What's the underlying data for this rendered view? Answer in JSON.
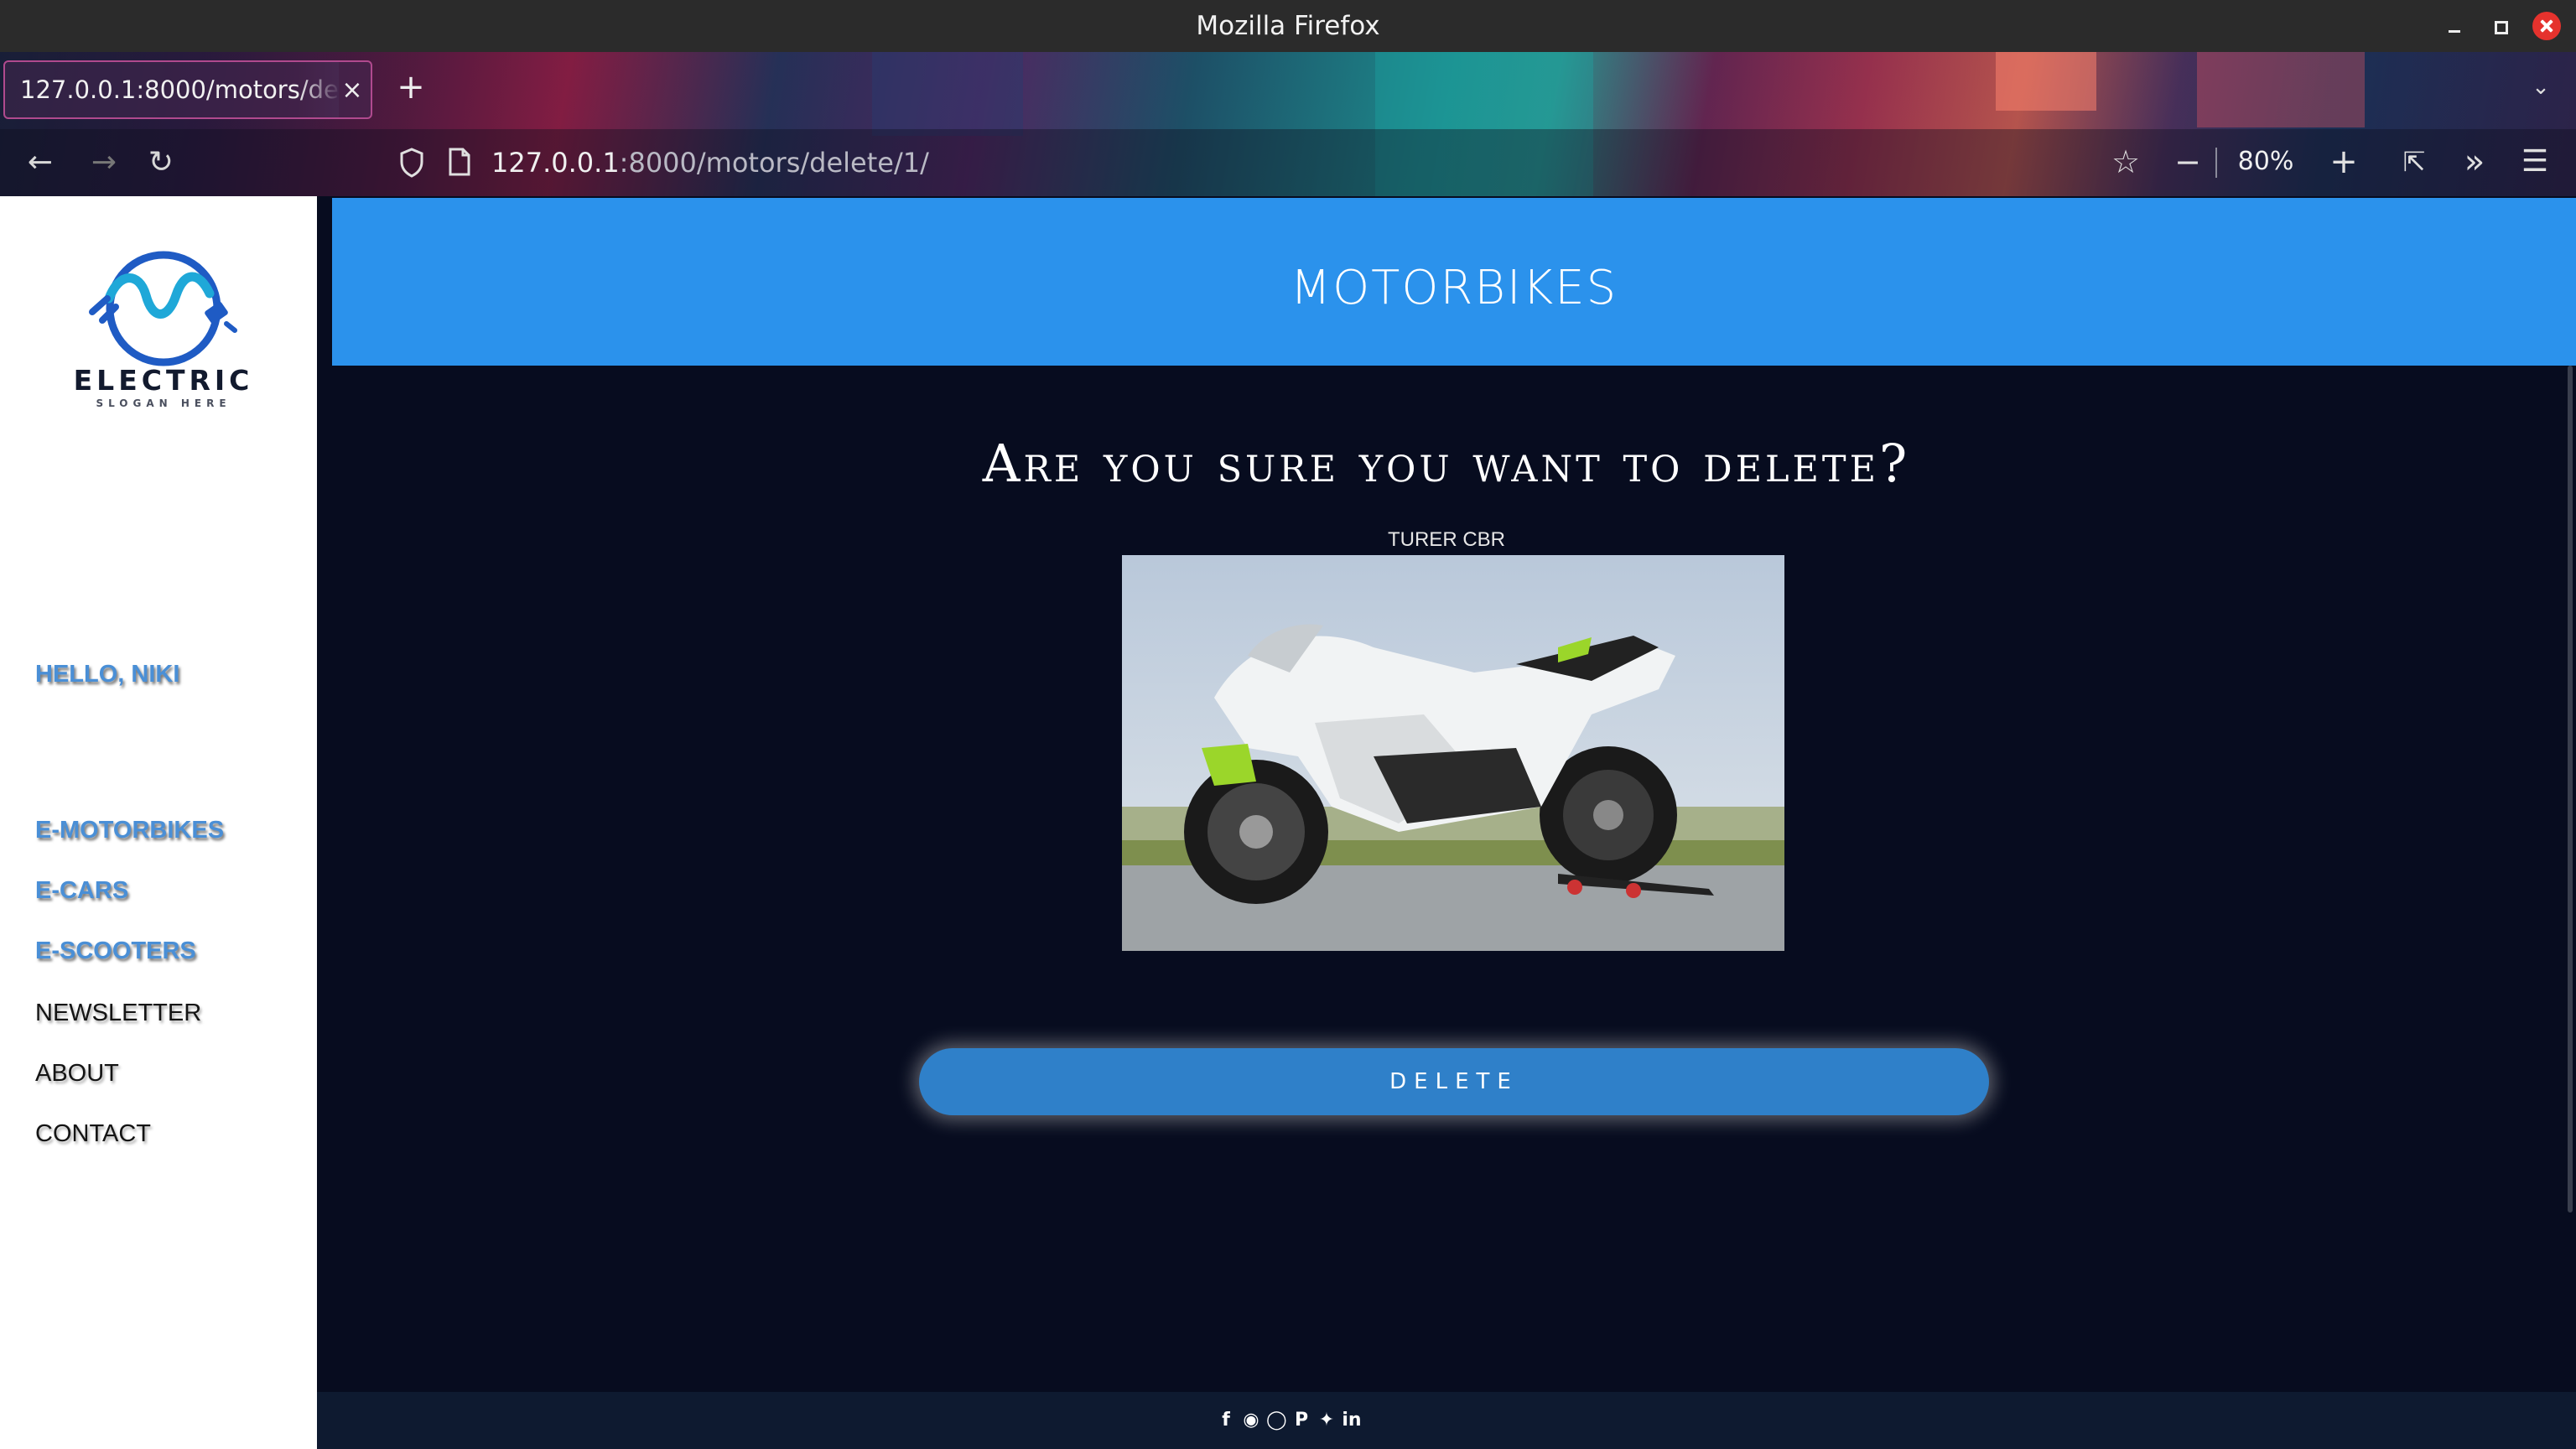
{
  "window": {
    "title": "Mozilla Firefox",
    "controls": [
      "minimize-icon",
      "maximize-icon",
      "close-icon"
    ]
  },
  "browser": {
    "tab": {
      "title": "127.0.0.1:8000/motors/delete/1/",
      "close": "×"
    },
    "new_tab": "+",
    "tab_list": "⌄",
    "url": {
      "host": "127.0.0.1",
      "rest": ":8000/motors/delete/1/"
    },
    "zoom": {
      "level": "80%",
      "out": "−",
      "in": "+"
    }
  },
  "sidebar": {
    "logo": {
      "name": "ELECTRIC",
      "slogan": "SLOGAN HERE",
      "accent": "#1f5bc4"
    },
    "greeting": "HELLO, NIKI",
    "nav": [
      {
        "label": "E-MOTORBIKES"
      },
      {
        "label": "E-CARS"
      },
      {
        "label": "E-SCOOTERS"
      },
      {
        "label": "NEWSLETTER"
      },
      {
        "label": "ABOUT"
      },
      {
        "label": "CONTACT"
      }
    ]
  },
  "header": {
    "title": "MOTORBIKES",
    "color": "#2b92ec"
  },
  "main": {
    "heading": "Are you sure you want to delete?",
    "item_name": "TURER CBR",
    "delete_button": "DELETE"
  },
  "footer": {
    "social": [
      "facebook-icon",
      "instagram-icon",
      "snapchat-icon",
      "pinterest-icon",
      "twitter-icon",
      "linkedin-icon"
    ]
  },
  "colors": {
    "page_bg": "#070c1f",
    "button": "#2f80c9",
    "nav_blue": "#4a8fd6",
    "footer_bg": "#0e1a30"
  }
}
